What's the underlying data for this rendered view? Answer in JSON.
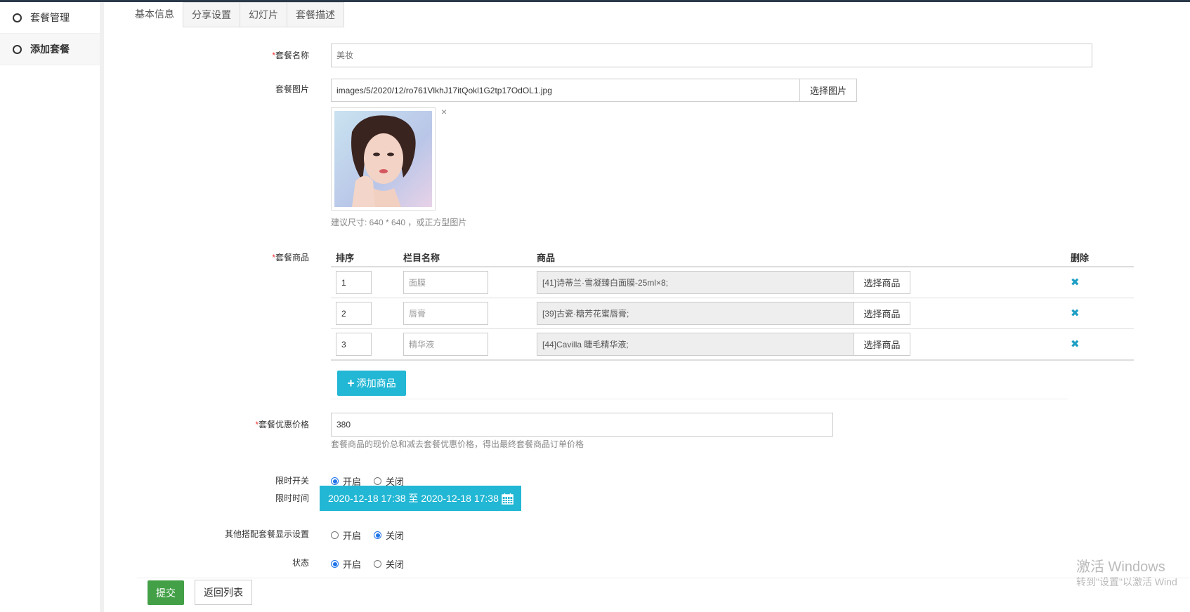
{
  "sidebar": {
    "items": [
      {
        "label": "套餐管理"
      },
      {
        "label": "添加套餐"
      }
    ]
  },
  "tabs": [
    "基本信息",
    "分享设置",
    "幻灯片",
    "套餐描述"
  ],
  "form": {
    "name": {
      "label": "套餐名称",
      "placeholder": "美妆"
    },
    "image": {
      "label": "套餐图片",
      "value": "images/5/2020/12/ro761VlkhJ17itQokl1G2tp17OdOL1.jpg",
      "button": "选择图片",
      "remove": "×",
      "help": "建议尺寸: 640 * 640 ，或正方型图片"
    },
    "goods": {
      "label": "套餐商品",
      "headers": {
        "sort": "排序",
        "column": "栏目名称",
        "goods": "商品",
        "delete": "删除"
      },
      "rows": [
        {
          "sort": "1",
          "column": "面膜",
          "goods": "[41]诗蒂兰·雪凝臻白面膜-25ml×8;",
          "button": "选择商品",
          "del": "✖"
        },
        {
          "sort": "2",
          "column": "唇膏",
          "goods": "[39]古瓷·糖芳花蜜唇膏;",
          "button": "选择商品",
          "del": "✖"
        },
        {
          "sort": "3",
          "column": "精华液",
          "goods": "[44]Cavilla 睫毛精华液;",
          "button": "选择商品",
          "del": "✖"
        }
      ],
      "add_button": "添加商品"
    },
    "price": {
      "label": "套餐优惠价格",
      "value": "380",
      "help": "套餐商品的现价总和减去套餐优惠价格，得出最终套餐商品订单价格"
    },
    "limit_switch": {
      "label": "限时开关",
      "options": [
        "开启",
        "关闭"
      ],
      "selected": "开启"
    },
    "limit_time": {
      "label": "限时时间",
      "value": "2020-12-18 17:38 至 2020-12-18 17:38"
    },
    "other_display": {
      "label": "其他搭配套餐显示设置",
      "options": [
        "开启",
        "关闭"
      ],
      "selected": "关闭"
    },
    "status": {
      "label": "状态",
      "options": [
        "开启",
        "关闭"
      ],
      "selected": "开启"
    },
    "submit": "提交",
    "back": "返回列表"
  },
  "watermark": {
    "line1": "激活 Windows",
    "line2": "转到\"设置\"以激活 Wind"
  },
  "colors": {
    "accent": "#22b7d4",
    "submit": "#43a047",
    "required": "#ee3333"
  }
}
